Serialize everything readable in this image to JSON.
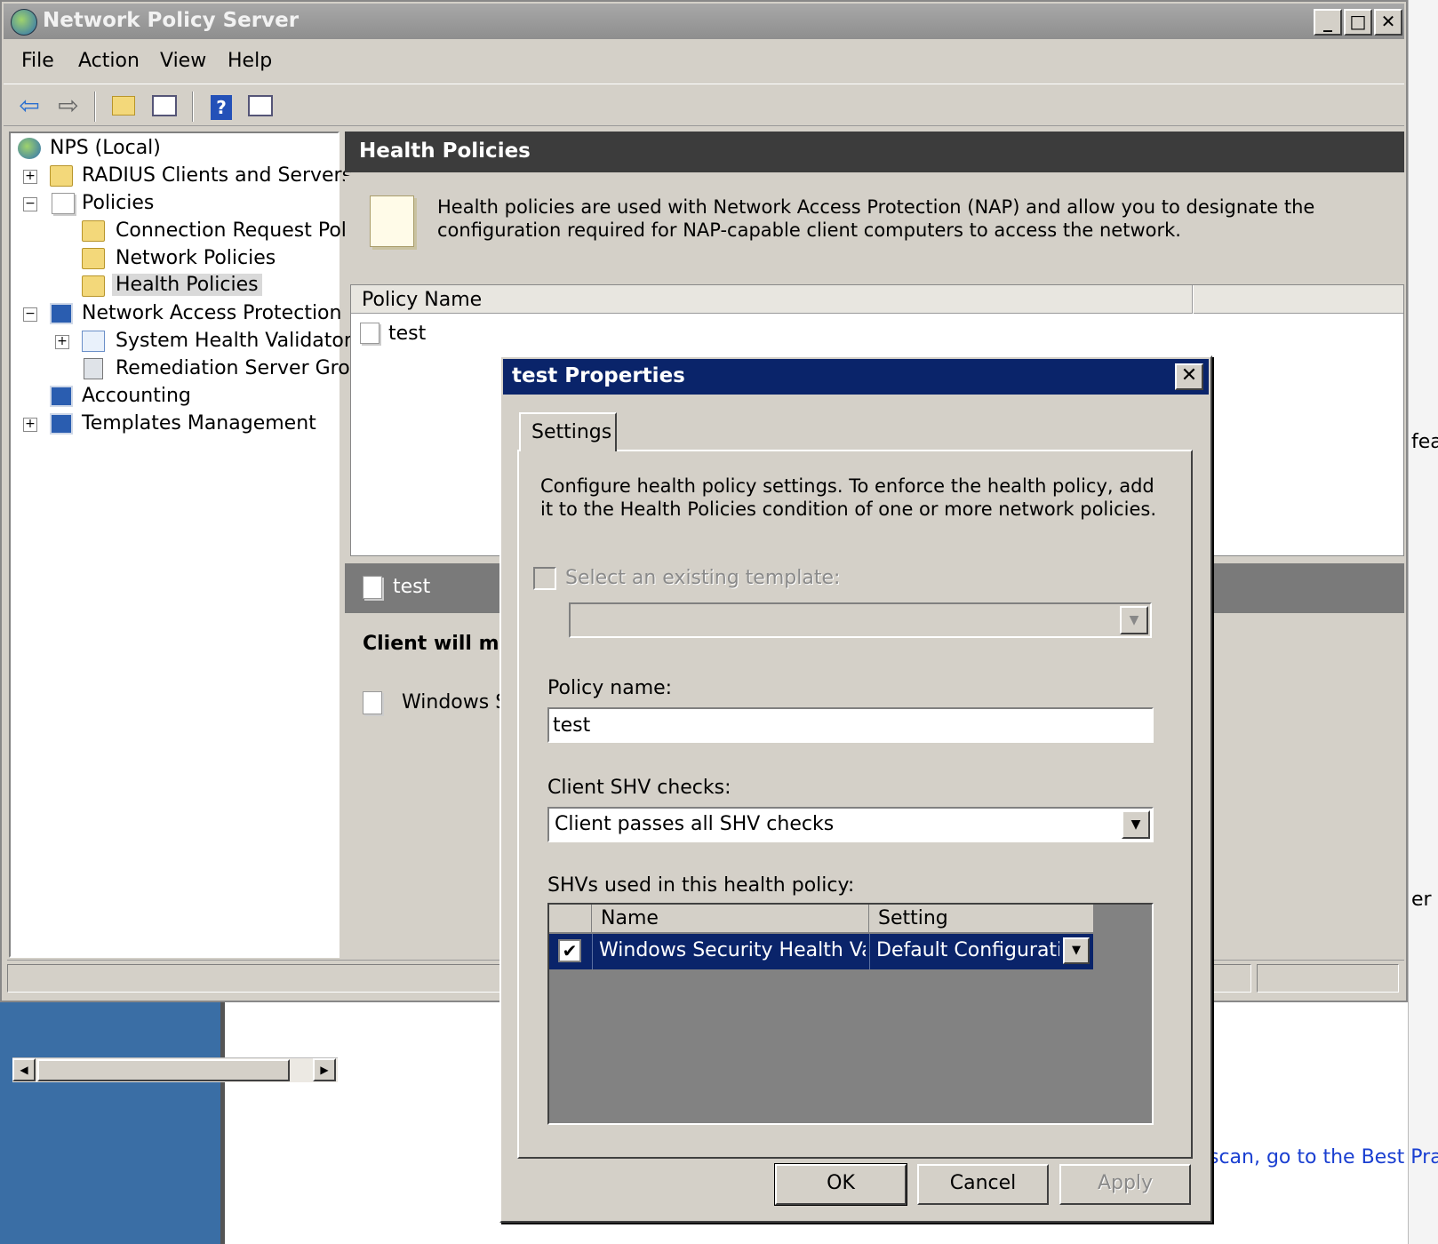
{
  "window": {
    "title": "Network Policy Server",
    "minimize": "_",
    "maximize": "□",
    "close": "✕"
  },
  "menu": [
    "File",
    "Action",
    "View",
    "Help"
  ],
  "toolbar": {
    "icons": [
      "back-arrow-icon",
      "forward-arrow-icon",
      "up-folder-icon",
      "show-hide-tree-icon",
      "help-icon",
      "show-hide-action-pane-icon"
    ]
  },
  "tree": {
    "root": "NPS (Local)",
    "radius": "RADIUS Clients and Servers",
    "policies": "Policies",
    "connection_request": "Connection Request Polici",
    "network_policies": "Network Policies",
    "health_policies": "Health Policies",
    "nap": "Network Access Protection",
    "shv": "System Health Validators",
    "remediation": "Remediation Server Group",
    "accounting": "Accounting",
    "templates": "Templates Management"
  },
  "content": {
    "title": "Health Policies",
    "description": "Health policies are used with Network Access Protection (NAP) and allow you to designate the configuration required for NAP-capable client computers to access the network.",
    "column_policy_name": "Policy Name",
    "rows": [
      "test"
    ],
    "detail_name": "test",
    "detail_heading": "Client will me",
    "detail_item": "Windows S"
  },
  "background": {
    "best_practices_link": "scan, go to the Best Practic",
    "fragment_1": "fea",
    "fragment_2": "er l"
  },
  "dialog": {
    "title": "test Properties",
    "close": "✕",
    "tab": "Settings",
    "description": "Configure health policy settings. To enforce the health policy, add it to the Health Policies condition of one or more network policies.",
    "template_checkbox_label": "Select an existing template:",
    "template_value": "",
    "policy_name_label": "Policy name:",
    "policy_name_value": "test",
    "client_shv_label": "Client SHV checks:",
    "client_shv_value": "Client passes all SHV checks",
    "shvs_label": "SHVs used in this health policy:",
    "shv_table": {
      "col_name": "Name",
      "col_setting": "Setting",
      "rows": [
        {
          "checked": true,
          "check_glyph": "✔",
          "name": "Windows Security Health Vali...",
          "setting": "Default Configuration"
        }
      ]
    },
    "buttons": {
      "ok": "OK",
      "cancel": "Cancel",
      "apply": "Apply"
    }
  }
}
